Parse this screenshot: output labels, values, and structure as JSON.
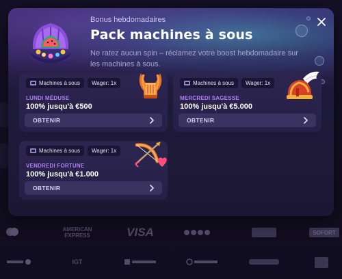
{
  "modal": {
    "subtitle": "Bonus hebdomadaires",
    "title": "Pack machines à sous",
    "description": "Ne ratez aucun spin – réclamez votre boost hebdomadaire sur les machines à sous."
  },
  "cards": [
    {
      "category": "Machines à sous",
      "wager": "Wager: 1x",
      "day": "LUNDI MÉDUSE",
      "amount": "100% jusqu'à €500",
      "cta": "OBTENIR",
      "art": "lyre-icon"
    },
    {
      "category": "Machines à sous",
      "wager": "Wager: 1x",
      "day": "MERCREDI SAGESSE",
      "amount": "100% jusqu'à €5.000",
      "cta": "OBTENIR",
      "art": "winged-helmet-icon"
    },
    {
      "category": "Machines à sous",
      "wager": "Wager: 1x",
      "day": "VENDREDI FORTUNE",
      "amount": "100% jusqu'à €1.000",
      "cta": "OBTENIR",
      "art": "bow-arrow-icon"
    }
  ],
  "footer": {
    "row1": [
      "AMERICAN EXPRESS",
      "VISA",
      "SOFORT"
    ],
    "row2": [
      "IGT"
    ]
  },
  "colors": {
    "accent": "#b27df5",
    "card_bg": "#2a2350",
    "button_bg": "#3a3362"
  }
}
